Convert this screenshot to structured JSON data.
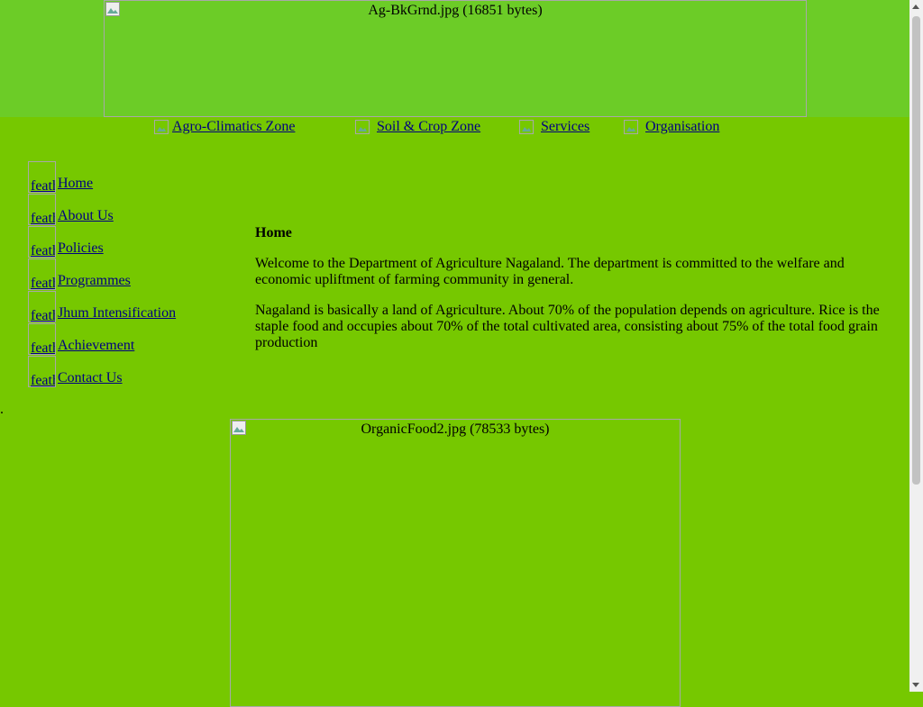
{
  "banner": {
    "alt": "Ag-BkGrnd.jpg (16851 bytes)"
  },
  "top_nav": [
    {
      "label": "Agro-Climatics Zone"
    },
    {
      "label": "Soil & Crop Zone"
    },
    {
      "label": "Services"
    },
    {
      "label": "Organisation"
    }
  ],
  "side_nav": {
    "icon_alt": "feath",
    "items": [
      {
        "label": "Home"
      },
      {
        "label": "About Us"
      },
      {
        "label": "Policies"
      },
      {
        "label": "Programmes"
      },
      {
        "label": "Jhum Intensification"
      },
      {
        "label": "Achievement"
      },
      {
        "label": "Contact Us"
      }
    ]
  },
  "content": {
    "heading": "Home",
    "paragraphs": [
      "Welcome to the Department of Agriculture Nagaland. The department is committed to the welfare and economic upliftment of farming community in general.",
      "Nagaland is basically a land of Agriculture. About 70% of the population depends on agriculture. Rice is the staple food and occupies about 70% of the total cultivated area, consisting about 75% of the total food grain production"
    ]
  },
  "stray_text": ".",
  "organic_image": {
    "alt": "OrganicFood2.jpg (78533 bytes)"
  },
  "colors": {
    "page_bg": "#76c800",
    "banner_band": "#6ccc27",
    "link": "#000080"
  }
}
